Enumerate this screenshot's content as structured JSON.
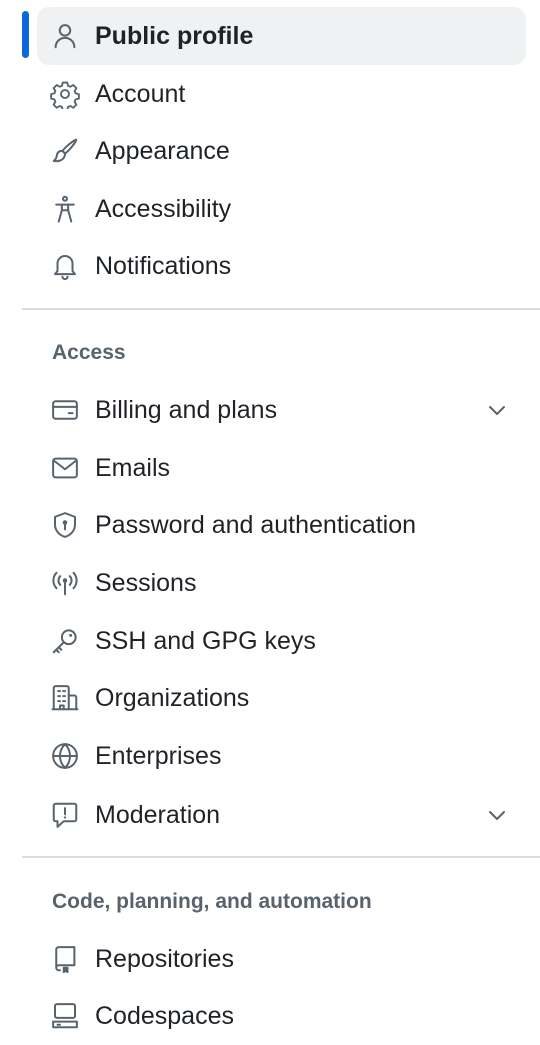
{
  "nav": {
    "groups": [
      {
        "items": [
          {
            "label": "Public profile",
            "icon": "person-icon",
            "active": true
          },
          {
            "label": "Account",
            "icon": "gear-icon"
          },
          {
            "label": "Appearance",
            "icon": "paintbrush-icon"
          },
          {
            "label": "Accessibility",
            "icon": "accessibility-icon"
          },
          {
            "label": "Notifications",
            "icon": "bell-icon"
          }
        ]
      },
      {
        "heading": "Access",
        "items": [
          {
            "label": "Billing and plans",
            "icon": "credit-card-icon",
            "expandable": true
          },
          {
            "label": "Emails",
            "icon": "mail-icon"
          },
          {
            "label": "Password and authentication",
            "icon": "shield-lock-icon"
          },
          {
            "label": "Sessions",
            "icon": "broadcast-icon"
          },
          {
            "label": "SSH and GPG keys",
            "icon": "key-icon"
          },
          {
            "label": "Organizations",
            "icon": "organization-icon"
          },
          {
            "label": "Enterprises",
            "icon": "globe-icon"
          },
          {
            "label": "Moderation",
            "icon": "report-icon",
            "expandable": true
          }
        ]
      },
      {
        "heading": "Code, planning, and automation",
        "items": [
          {
            "label": "Repositories",
            "icon": "repo-icon"
          },
          {
            "label": "Codespaces",
            "icon": "codespaces-icon"
          }
        ]
      }
    ]
  },
  "colors": {
    "accent": "#0969da",
    "active_background": "#eff1f3",
    "heading_text": "#59636e",
    "divider": "#d8dee4",
    "text": "#1f2328"
  }
}
